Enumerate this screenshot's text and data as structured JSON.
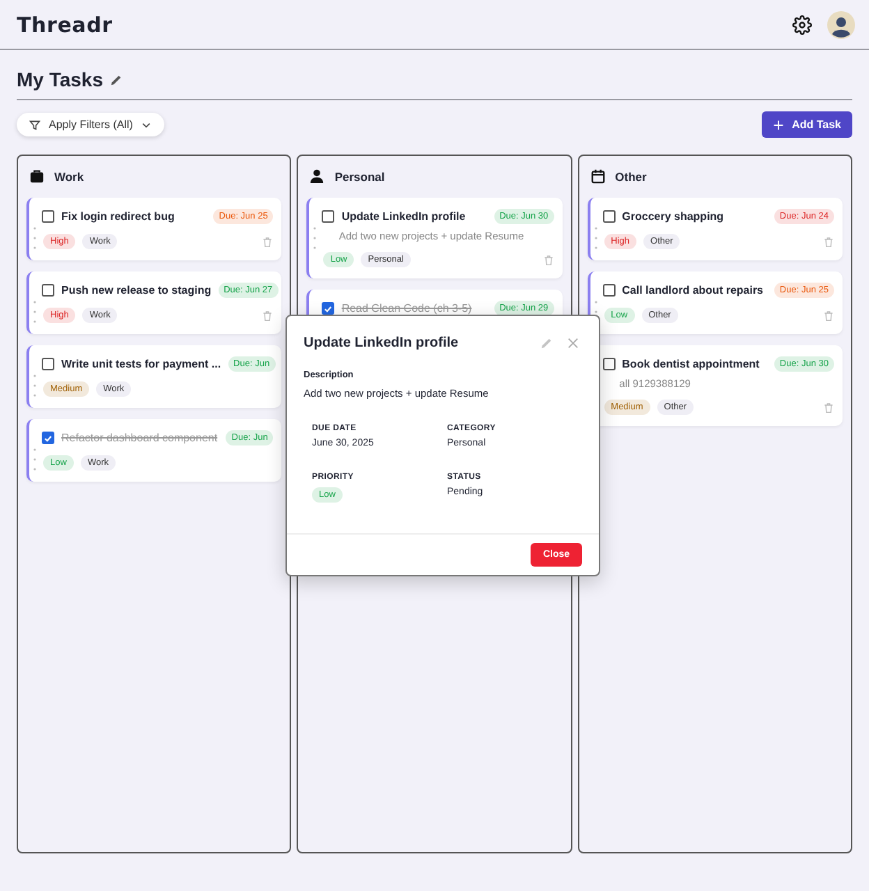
{
  "app": {
    "logo": "Threadr"
  },
  "page": {
    "title": "My Tasks"
  },
  "toolbar": {
    "filter": "Apply Filters (All)",
    "add": "Add Task"
  },
  "columns": [
    {
      "title": "Work",
      "kind": "work",
      "cards": [
        {
          "title": "Fix login redirect bug",
          "checked": false,
          "due": {
            "text": "Due: Jun 25",
            "color": "#ea580c"
          },
          "priority": {
            "text": "High",
            "color": "#dc2626"
          },
          "category": "Work",
          "delete_icon": true
        },
        {
          "title": "Push new release to staging",
          "checked": false,
          "due": {
            "text": "Due: Jun 27",
            "color": "#16a34a"
          },
          "priority": {
            "text": "High",
            "color": "#dc2626"
          },
          "category": "Work",
          "delete_icon": true
        },
        {
          "title": "Write unit tests for payment ...",
          "checked": false,
          "due": {
            "text": "Due: Jun",
            "color": "#16a34a"
          },
          "priority": {
            "text": "Medium",
            "color": "#a16207"
          },
          "category": "Work",
          "delete_icon": false
        },
        {
          "title": "Refactor dashboard component",
          "checked": true,
          "due": {
            "text": "Due: Jun",
            "color": "#16a34a"
          },
          "priority": {
            "text": "Low",
            "color": "#16a34a"
          },
          "category": "Work",
          "delete_icon": false
        }
      ]
    },
    {
      "title": "Personal",
      "kind": "personal",
      "cards": [
        {
          "title": "Update LinkedIn profile",
          "checked": false,
          "due": {
            "text": "Due: Jun 30",
            "color": "#16a34a"
          },
          "description": "Add two new projects + update Resume",
          "priority": {
            "text": "Low",
            "color": "#16a34a"
          },
          "category": "Personal",
          "delete_icon": true
        },
        {
          "title": "Read Clean Code (ch 3-5)",
          "checked": true,
          "due": {
            "text": "Due: Jun 29",
            "color": "#16a34a"
          },
          "delete_icon": false
        }
      ]
    },
    {
      "title": "Other",
      "kind": "other",
      "cards": [
        {
          "title": "Groccery shapping",
          "checked": false,
          "due": {
            "text": "Due: Jun 24",
            "color": "#dc2626"
          },
          "priority": {
            "text": "High",
            "color": "#dc2626"
          },
          "category": "Other",
          "delete_icon": true
        },
        {
          "title": "Call landlord about repairs",
          "checked": false,
          "due": {
            "text": "Due: Jun 25",
            "color": "#ea580c"
          },
          "priority": {
            "text": "Low",
            "color": "#16a34a"
          },
          "category": "Other",
          "delete_icon": true
        },
        {
          "title": "Book dentist appointment",
          "checked": false,
          "due": {
            "text": "Due: Jun 30",
            "color": "#16a34a"
          },
          "description": "all 9129388129",
          "priority": {
            "text": "Medium",
            "color": "#a16207"
          },
          "category": "Other",
          "delete_icon": true
        }
      ]
    }
  ],
  "dialog": {
    "title": "Update LinkedIn profile",
    "description_label": "Description",
    "description": "Add two new projects + update Resume",
    "fields": [
      {
        "label": "DUE DATE",
        "value": "June 30, 2025"
      },
      {
        "label": "CATEGORY",
        "value": "Personal"
      },
      {
        "label": "PRIORITY",
        "tag": {
          "text": "Low",
          "color": "#16a34a"
        }
      },
      {
        "label": "STATUS",
        "value": "Pending"
      }
    ],
    "close": "Close"
  }
}
